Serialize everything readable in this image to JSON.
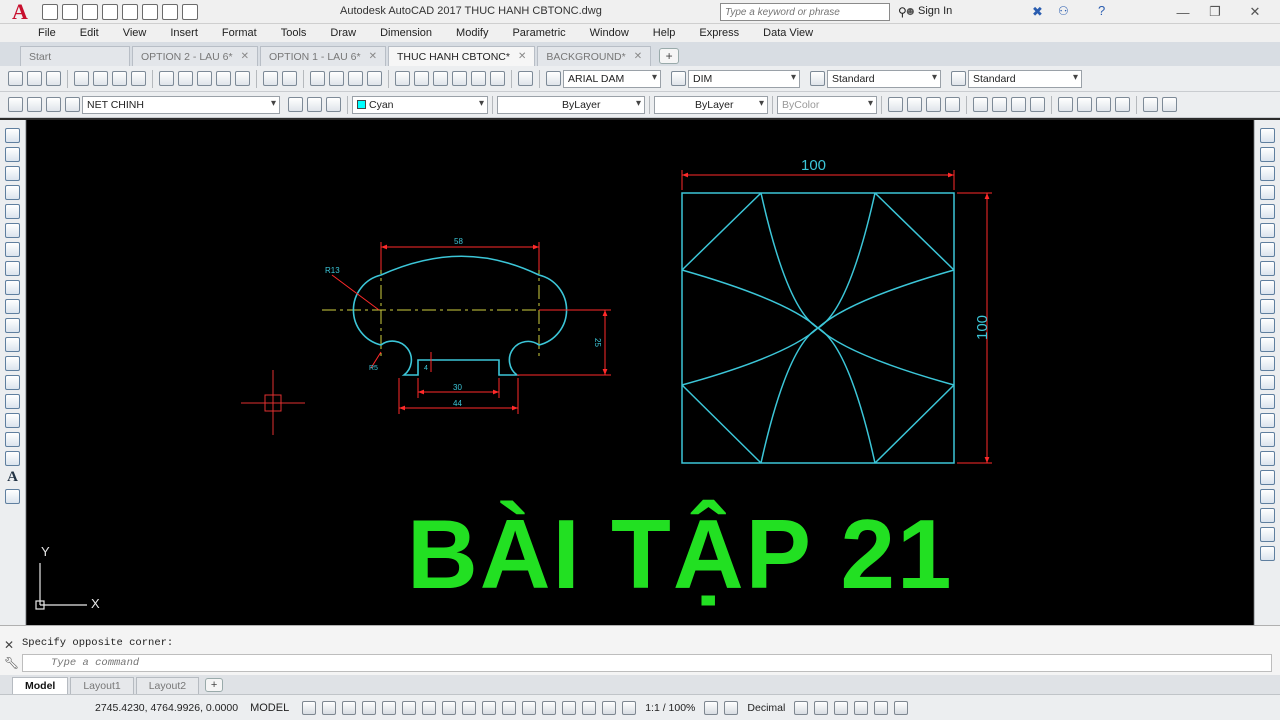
{
  "window": {
    "title": "Autodesk AutoCAD 2017    THUC HANH CBTONC.dwg",
    "logo": "A",
    "search_placeholder": "Type a keyword or phrase",
    "signin_label": "Sign In",
    "minimize": "—",
    "restore": "❐",
    "close": "✕"
  },
  "menu": [
    "File",
    "Edit",
    "View",
    "Insert",
    "Format",
    "Tools",
    "Draw",
    "Dimension",
    "Modify",
    "Parametric",
    "Window",
    "Help",
    "Express",
    "Data View"
  ],
  "file_tabs": [
    {
      "label": "Start",
      "active": false,
      "closable": false
    },
    {
      "label": "OPTION 2 - LAU 6*",
      "active": false,
      "closable": true
    },
    {
      "label": "OPTION 1 - LAU 6*",
      "active": false,
      "closable": true
    },
    {
      "label": "THUC HANH CBTONC*",
      "active": true,
      "closable": true
    },
    {
      "label": "BACKGROUND*",
      "active": false,
      "closable": true
    }
  ],
  "toolbar1": {
    "text_style": "ARIAL DAM",
    "dim_style": "DIM",
    "table_style": "Standard",
    "multileader_style": "Standard"
  },
  "toolbar2": {
    "layer": "NET CHINH",
    "color": "Cyan",
    "linetype": "ByLayer",
    "lineweight": "ByLayer",
    "plotstyle": "ByColor"
  },
  "canvas": {
    "background": "#000000",
    "ucs_y": "Y",
    "ucs_x": "X",
    "title_text": "BÀI TẬP 21",
    "title_color": "#22e022",
    "drawing_color": "#3cc6d8",
    "dim_color": "#ff2a2a",
    "small_dims": {
      "top_width": "58",
      "radius": "R13",
      "right_height": "25",
      "notch_width": "30",
      "notch_depth": "4",
      "bottom_width": "44",
      "left_callout": "R5"
    },
    "square_dims": {
      "width": "100",
      "height": "100"
    }
  },
  "command": {
    "history": "Specify opposite corner:",
    "placeholder": "Type a command"
  },
  "layout_tabs": [
    {
      "label": "Model",
      "active": true
    },
    {
      "label": "Layout1",
      "active": false
    },
    {
      "label": "Layout2",
      "active": false
    }
  ],
  "status": {
    "coords": "2745.4230, 4764.9926, 0.0000",
    "model": "MODEL",
    "scale": "1:1 / 100%",
    "units": "Decimal"
  }
}
